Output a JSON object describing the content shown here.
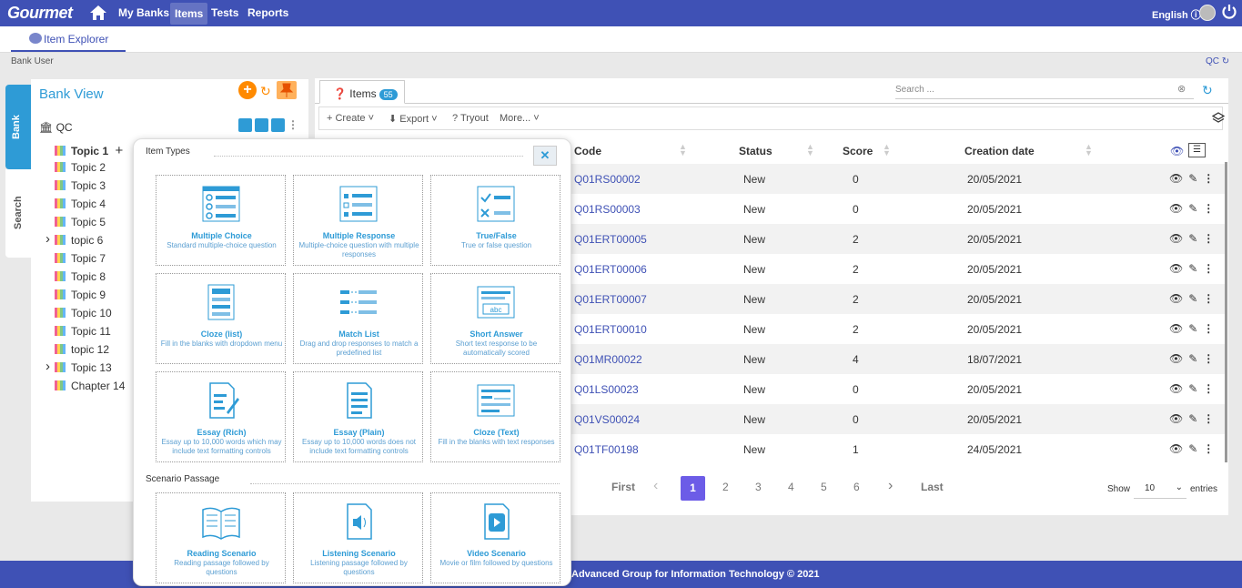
{
  "app": {
    "logo": "Gourmet",
    "nav": [
      "My Banks",
      "Items",
      "Tests",
      "Reports"
    ],
    "language": "English",
    "copyright": "Advanced Group for Information Technology © 2021"
  },
  "subnav": {
    "tab": "Item Explorer",
    "user": "Bank User",
    "qc": "QC"
  },
  "side_tabs": {
    "bank": "Bank",
    "search": "Search"
  },
  "bank": {
    "title": "Bank View",
    "root": "QC",
    "topics": [
      "Topic 1",
      "Topic 2",
      "Topic 3",
      "Topic 4",
      "Topic 5",
      "topic 6",
      "Topic 7",
      "Topic 8",
      "Topic 9",
      "Topic 10",
      "Topic 11",
      "topic 12",
      "Topic 13",
      "Chapter 14"
    ]
  },
  "items": {
    "tab": "Items",
    "count": "55",
    "search_placeholder": "Search ...",
    "toolbar": {
      "create": "Create",
      "export": "Export",
      "tryout": "Tryout",
      "more": "More..."
    },
    "columns": {
      "code": "Code",
      "status": "Status",
      "score": "Score",
      "date": "Creation date"
    },
    "rows": [
      {
        "code": "Q01RS00002",
        "status": "New",
        "score": "0",
        "date": "20/05/2021"
      },
      {
        "code": "Q01RS00003",
        "status": "New",
        "score": "0",
        "date": "20/05/2021"
      },
      {
        "code": "Q01ERT00005",
        "status": "New",
        "score": "2",
        "date": "20/05/2021"
      },
      {
        "code": "Q01ERT00006",
        "status": "New",
        "score": "2",
        "date": "20/05/2021"
      },
      {
        "code": "Q01ERT00007",
        "status": "New",
        "score": "2",
        "date": "20/05/2021"
      },
      {
        "code": "Q01ERT00010",
        "status": "New",
        "score": "2",
        "date": "20/05/2021"
      },
      {
        "code": "Q01MR00022",
        "status": "New",
        "score": "4",
        "date": "18/07/2021"
      },
      {
        "code": "Q01LS00023",
        "status": "New",
        "score": "0",
        "date": "20/05/2021"
      },
      {
        "code": "Q01VS00024",
        "status": "New",
        "score": "0",
        "date": "20/05/2021"
      },
      {
        "code": "Q01TF00198",
        "status": "New",
        "score": "1",
        "date": "24/05/2021"
      }
    ],
    "pagination": {
      "first": "First",
      "last": "Last",
      "pages": [
        "1",
        "2",
        "3",
        "4",
        "5",
        "6"
      ],
      "current": "1"
    },
    "show": "Show",
    "entries_value": "10",
    "entries": "entries"
  },
  "popup": {
    "item_types_title": "Item Types",
    "scenario_title": "Scenario Passage",
    "types": [
      {
        "name": "Multiple Choice",
        "desc": "Standard multiple-choice question"
      },
      {
        "name": "Multiple Response",
        "desc": "Multiple-choice question with multiple responses"
      },
      {
        "name": "True/False",
        "desc": "True or false question"
      },
      {
        "name": "Cloze (list)",
        "desc": "Fill in the blanks with dropdown menu"
      },
      {
        "name": "Match List",
        "desc": "Drag and drop responses to match a predefined list"
      },
      {
        "name": "Short Answer",
        "desc": "Short text response to be automatically scored"
      },
      {
        "name": "Essay (Rich)",
        "desc": "Essay up to 10,000 words which may include text formatting controls"
      },
      {
        "name": "Essay (Plain)",
        "desc": "Essay up to 10,000 words does not include text formatting controls"
      },
      {
        "name": "Cloze (Text)",
        "desc": "Fill in the blanks with text responses"
      }
    ],
    "scenarios": [
      {
        "name": "Reading Scenario",
        "desc": "Reading passage followed by questions"
      },
      {
        "name": "Listening Scenario",
        "desc": "Listening passage followed by questions"
      },
      {
        "name": "Video Scenario",
        "desc": "Movie or film followed by questions"
      }
    ],
    "short_answer_icon_text": "abc"
  }
}
